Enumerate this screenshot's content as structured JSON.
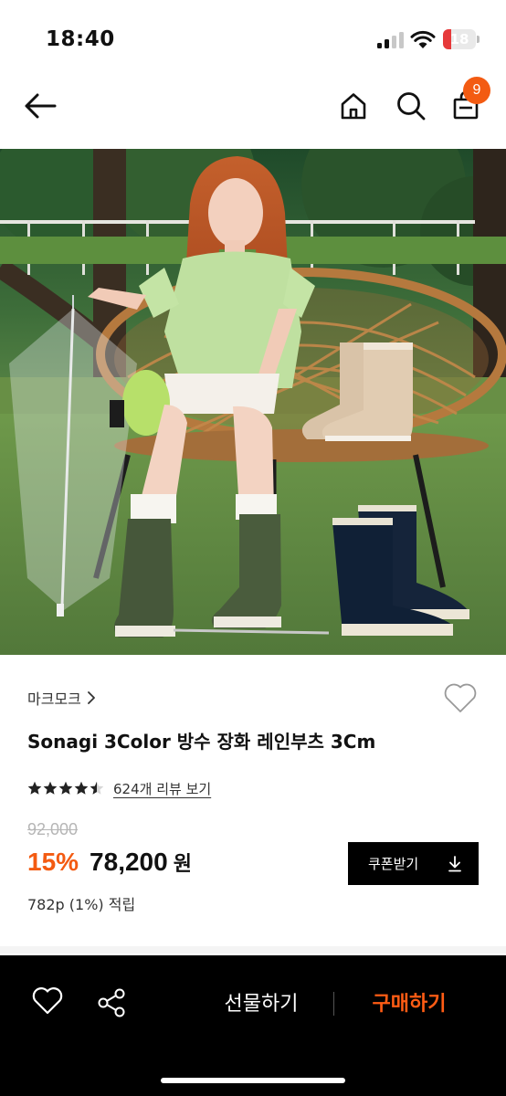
{
  "status_bar": {
    "time": "18:40",
    "battery_level": "18",
    "battery_color": "#e6393a"
  },
  "header": {
    "back_icon": "arrow-left-icon",
    "home_icon": "home-icon",
    "search_icon": "search-icon",
    "cart_icon": "shopping-bag-icon",
    "cart_count": "9",
    "accent_color": "#f35b12"
  },
  "product": {
    "image_description_icon": "product-photo",
    "brand": "마크모크",
    "brand_chevron_icon": "chevron-right-icon",
    "wishlist_icon": "heart-outline-icon",
    "title": "Sonagi 3Color 방수 장화 레인부츠 3Cm",
    "rating": 4.5,
    "rating_max": 5,
    "review_link": "624개 리뷰 보기",
    "original_price": "92,000",
    "discount": "15%",
    "sale_price": "78,200",
    "currency": "원",
    "points": "782p (1%) 적립",
    "coupon_label": "쿠폰받기",
    "coupon_icon": "download-icon"
  },
  "bottom_bar": {
    "wishlist_icon": "heart-outline-icon",
    "share_icon": "share-icon",
    "gift_label": "선물하기",
    "buy_label": "구매하기",
    "buy_color": "#ff5c14"
  }
}
